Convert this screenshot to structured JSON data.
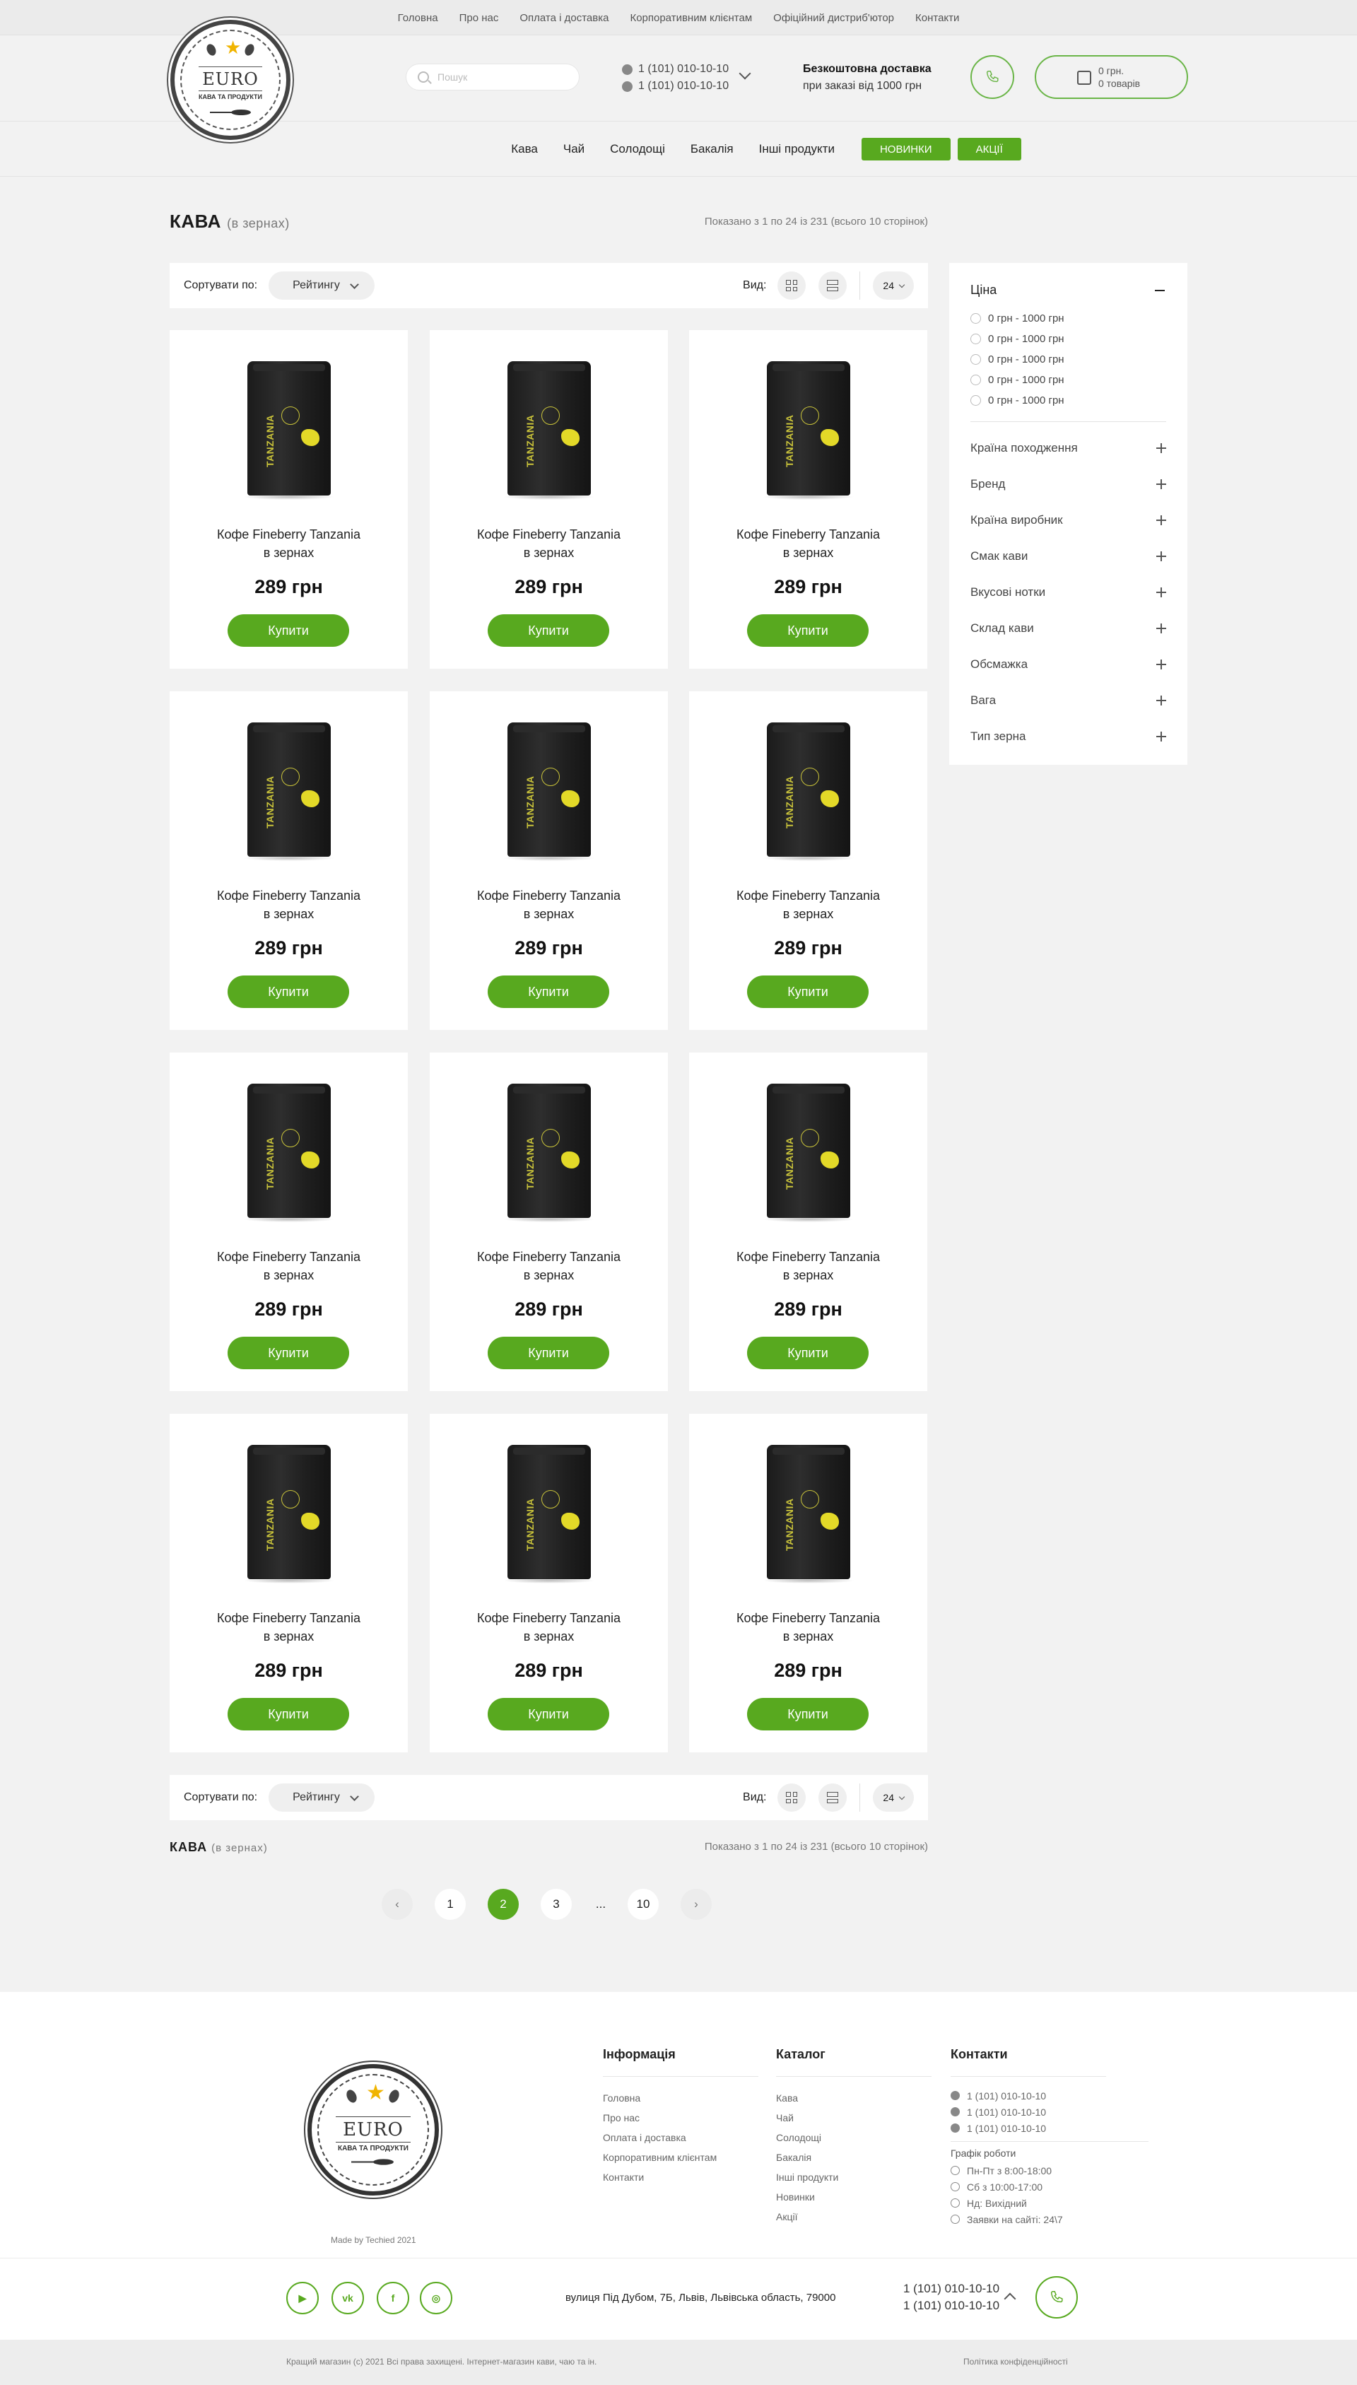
{
  "topnav": [
    "Головна",
    "Про нас",
    "Оплата і доставка",
    "Корпоративним клієнтам",
    "Офіційний дистриб'ютор",
    "Контакти"
  ],
  "logo": {
    "name": "EURO",
    "sub": "КАВА ТА ПРОДУКТИ"
  },
  "search": {
    "placeholder": "Пошук"
  },
  "phones": [
    "1 (101) 010-10-10",
    "1 (101) 010-10-10"
  ],
  "delivery": {
    "title": "Безкоштовна доставка",
    "sub": "при заказі від 1000 грн"
  },
  "cart": {
    "sum": "0 грн.",
    "count": "0 товарів"
  },
  "catnav": [
    "Кава",
    "Чай",
    "Солодощі",
    "Бакалія",
    "Інші продукти"
  ],
  "catnav_buttons": [
    "НОВИНКИ",
    "АКЦІЇ"
  ],
  "page": {
    "title": "КАВА",
    "subtitle": "(в зернах)",
    "shown": "Показано з 1 по 24 із 231 (всього 10 сторінок)"
  },
  "sort": {
    "label": "Сортувати по:",
    "value": "Рейтингу",
    "view_label": "Вид:",
    "per_page": "24"
  },
  "product": {
    "name1": "Кофе Fineberry Tanzania",
    "name2": "в зернах",
    "price": "289 грн",
    "buy": "Купити",
    "bag_label": "TANZANIA"
  },
  "filters": {
    "price_title": "Ціна",
    "price_options": [
      "0 грн - 1000 грн",
      "0 грн - 1000 грн",
      "0 грн - 1000 грн",
      "0 грн - 1000 грн",
      "0 грн - 1000 грн"
    ],
    "groups": [
      "Країна походження",
      "Бренд",
      "Країна виробник",
      "Смак кави",
      "Вкусові нотки",
      "Склад кави",
      "Обсмажка",
      "Вага",
      "Тип зерна"
    ]
  },
  "pagination": {
    "pages": [
      "1",
      "2",
      "3",
      "...",
      "10"
    ],
    "active": "2"
  },
  "footer": {
    "madeby": "Made by Techied 2021",
    "info_title": "Інформація",
    "info": [
      "Головна",
      "Про нас",
      "Оплата і доставка",
      "Корпоративним клієнтам",
      "Контакти"
    ],
    "catalog_title": "Каталог",
    "catalog": [
      "Кава",
      "Чай",
      "Солодощі",
      "Бакалія",
      "Інші продукти",
      "Новинки",
      "Акції"
    ],
    "contacts_title": "Контакти",
    "contact_phones": [
      "1 (101) 010-10-10",
      "1 (101) 010-10-10",
      "1 (101) 010-10-10"
    ],
    "schedule_title": "Графік роботи",
    "schedule": [
      "Пн-Пт з 8:00-18:00",
      "Сб з 10:00-17:00",
      "Нд: Вихідний",
      "Заявки на сайті: 24\\7"
    ],
    "address": "вулиця Під Дубом, 7Б, Львів, Львівська область, 79000",
    "phones": [
      "1 (101) 010-10-10",
      "1 (101) 010-10-10"
    ],
    "copyright": "Кращий магазин (c) 2021 Всі права захищені. Інтернет-магазин кави, чаю та ін.",
    "privacy": "Політика конфіденційності",
    "social": [
      "youtube-icon",
      "vk-icon",
      "facebook-icon",
      "instagram-icon"
    ]
  },
  "colors": {
    "accent": "#58a91f",
    "bg": "#f2f2f2"
  }
}
